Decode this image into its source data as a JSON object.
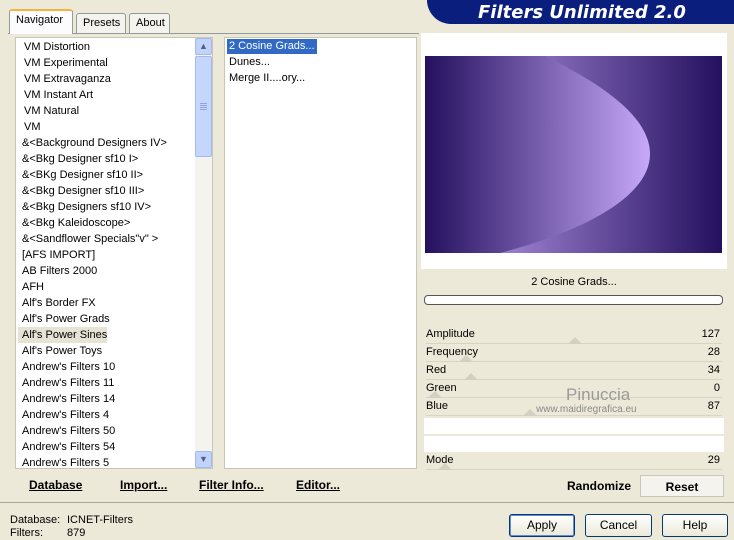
{
  "tabs": [
    {
      "label": "Navigator",
      "active": true
    },
    {
      "label": "Presets",
      "active": false
    },
    {
      "label": "About",
      "active": false
    }
  ],
  "banner": {
    "title": "Filters Unlimited 2.0",
    "color": "#0a1e7e"
  },
  "categories": [
    "VM Distortion",
    "VM Experimental",
    "VM Extravaganza",
    "VM Instant Art",
    "VM Natural",
    "VM",
    "&<Background Designers IV>",
    "&<Bkg Designer sf10 I>",
    "&<BKg Designer sf10 II>",
    "&<Bkg Designer sf10 III>",
    "&<Bkg Designers sf10 IV>",
    "&<Bkg Kaleidoscope>",
    "&<Sandflower Specials\"v\" >",
    "[AFS IMPORT]",
    "AB Filters 2000",
    "AFH",
    "Alf's Border FX",
    "Alf's Power Grads",
    "Alf's Power Sines",
    "Alf's Power Toys",
    "Andrew's Filters 10",
    "Andrew's Filters 11",
    "Andrew's Filters 14",
    "Andrew's Filters 4",
    "Andrew's Filters 50",
    "Andrew's Filters 54",
    "Andrew's Filters 5"
  ],
  "selected_category": "Alf's Power Sines",
  "filters": [
    "2 Cosine Grads...",
    "Dunes...",
    "Merge II....ory..."
  ],
  "selected_filter": "2 Cosine Grads...",
  "preview": {
    "filter_name": "2 Cosine Grads...",
    "dark_color": "#24105e",
    "light_color": "#c7a9f9"
  },
  "params": [
    {
      "label": "Amplitude",
      "value": "127",
      "level": 0.5
    },
    {
      "label": "Frequency",
      "value": "28",
      "level": 0.11
    },
    {
      "label": "Red",
      "value": "34",
      "level": 0.13
    },
    {
      "label": "Green",
      "value": "0",
      "level": 0.0
    },
    {
      "label": "Blue",
      "value": "87",
      "level": 0.34
    }
  ],
  "mode": {
    "label": "Mode",
    "value": "29"
  },
  "watermark": {
    "name": "Pinuccia",
    "url": "www.maidiregrafica.eu"
  },
  "bottom_buttons": {
    "database": "Database",
    "import": "Import...",
    "filter_info": "Filter Info...",
    "editor": "Editor...",
    "randomize": "Randomize",
    "reset": "Reset"
  },
  "status": {
    "database_label": "Database:",
    "database_value": "ICNET-Filters",
    "filters_label": "Filters:",
    "filters_value": "879"
  },
  "dialog_buttons": {
    "apply": "Apply",
    "cancel": "Cancel",
    "help": "Help"
  }
}
